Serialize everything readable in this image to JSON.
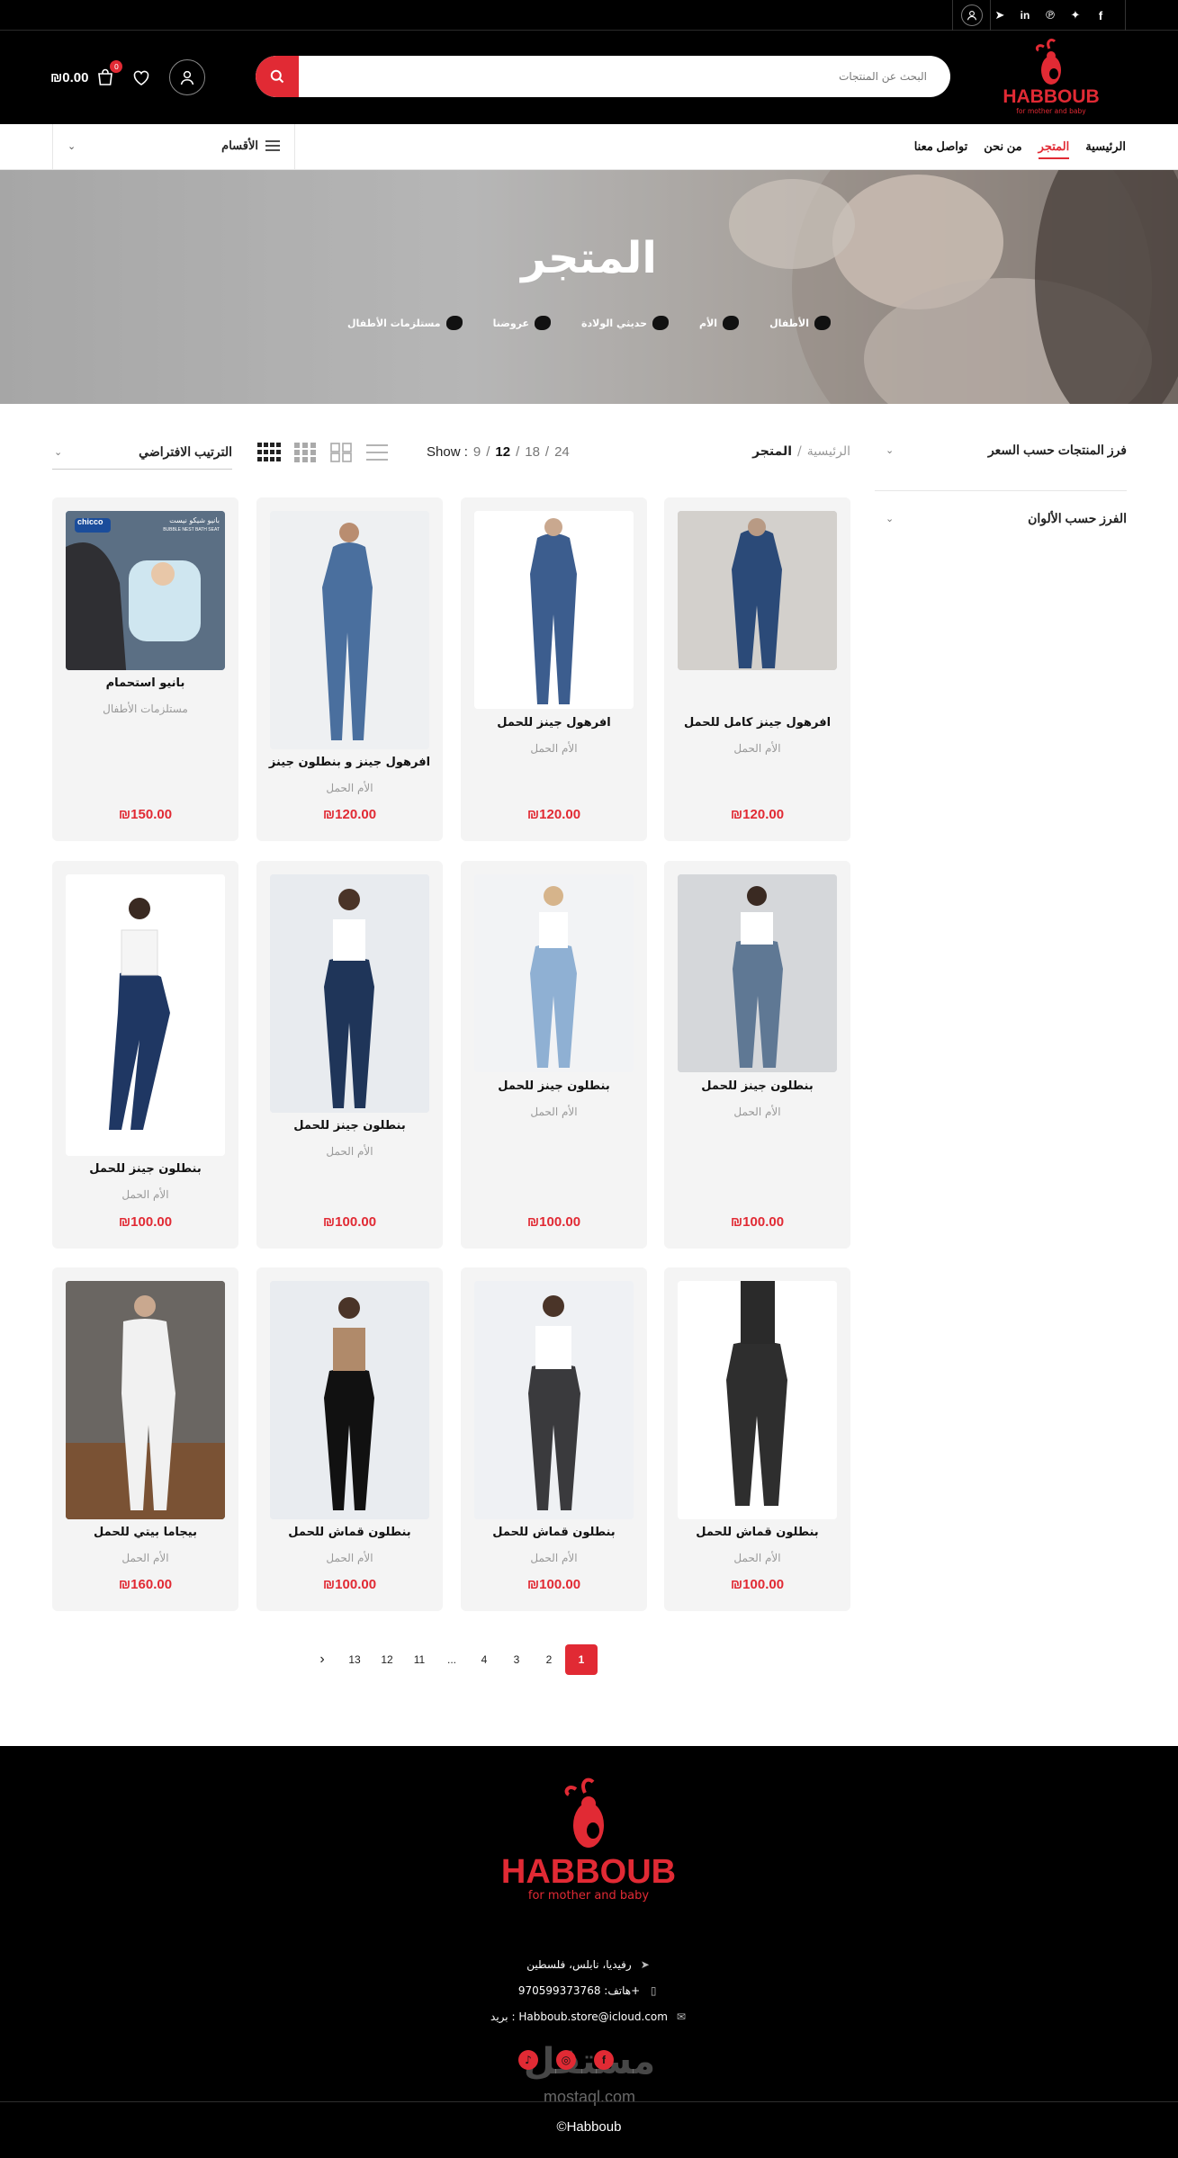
{
  "topbar": {
    "social_icons": [
      "telegram-icon",
      "linkedin-icon",
      "pinterest-icon",
      "twitter-icon",
      "facebook-icon"
    ]
  },
  "header": {
    "brand": "HABBOUB",
    "tagline": "for mother and baby",
    "search_placeholder": "البحث عن المنتجات",
    "cart_total": "₪0.00",
    "cart_count": "0"
  },
  "nav": {
    "items": [
      {
        "label": "الرئيسية"
      },
      {
        "label": "المتجر"
      },
      {
        "label": "من نحن"
      },
      {
        "label": "تواصل معنا"
      }
    ],
    "categories_label": "الأقسام"
  },
  "hero": {
    "title": "المتجر",
    "categories": [
      "الأطفال",
      "الأم",
      "حديثي الولادة",
      "عروضنا",
      "مستلزمات الأطفال"
    ]
  },
  "sidebar": {
    "filter_price": "فرز المنتجات حسب السعر",
    "filter_colors": "الفرز حسب الألوان"
  },
  "toolbar": {
    "breadcrumb_home": "الرئيسية",
    "breadcrumb_sep": "/",
    "breadcrumb_current": "المتجر",
    "show_label": "Show :",
    "show_options": [
      "9",
      "12",
      "18",
      "24"
    ],
    "show_active": "12",
    "sort_label": "الترتيب الافتراضي"
  },
  "products": [
    {
      "title": "افرهول جينز كامل للحمل",
      "category": "الأم الحمل",
      "price": "₪120.00"
    },
    {
      "title": "افرهول جينز للحمل",
      "category": "الأم الحمل",
      "price": "₪120.00"
    },
    {
      "title": "افرهول جينز و بنطلون جينز",
      "category": "الأم الحمل",
      "price": "₪120.00"
    },
    {
      "title": "بانيو استحمام",
      "category": "مستلزمات الأطفال",
      "price": "₪150.00",
      "badge_brand": "chicco",
      "badge_text": "بانيو شيكو نيست",
      "badge_sub": "BUBBLE NEST BATH SEAT"
    },
    {
      "title": "بنطلون جينز للحمل",
      "category": "الأم الحمل",
      "price": "₪100.00"
    },
    {
      "title": "بنطلون جينز للحمل",
      "category": "الأم الحمل",
      "price": "₪100.00"
    },
    {
      "title": "بنطلون جينز للحمل",
      "category": "الأم الحمل",
      "price": "₪100.00"
    },
    {
      "title": "بنطلون جينز للحمل",
      "category": "الأم الحمل",
      "price": "₪100.00"
    },
    {
      "title": "بنطلون قماش للحمل",
      "category": "الأم الحمل",
      "price": "₪100.00"
    },
    {
      "title": "بنطلون قماش للحمل",
      "category": "الأم الحمل",
      "price": "₪100.00"
    },
    {
      "title": "بنطلون قماش للحمل",
      "category": "الأم الحمل",
      "price": "₪100.00"
    },
    {
      "title": "بيجاما بيتي للحمل",
      "category": "الأم الحمل",
      "price": "₪160.00"
    }
  ],
  "pagination": {
    "pages": [
      "1",
      "2",
      "3",
      "4",
      "...",
      "11",
      "12",
      "13"
    ],
    "active": "1",
    "next": "‹"
  },
  "footer": {
    "brand": "HABBOUB",
    "tagline": "for mother and baby",
    "address": "رفيديا، نابلس، فلسطين",
    "phone": "هاتف: 970599373768+",
    "email": "بريد : Habboub.store@icloud.com",
    "watermark": "مستقل",
    "watermark_url": "mostaql.com",
    "copyright": "©Habboub"
  },
  "colors": {
    "accent": "#e12a34",
    "dark": "#000000",
    "card_bg": "#f4f4f4"
  }
}
